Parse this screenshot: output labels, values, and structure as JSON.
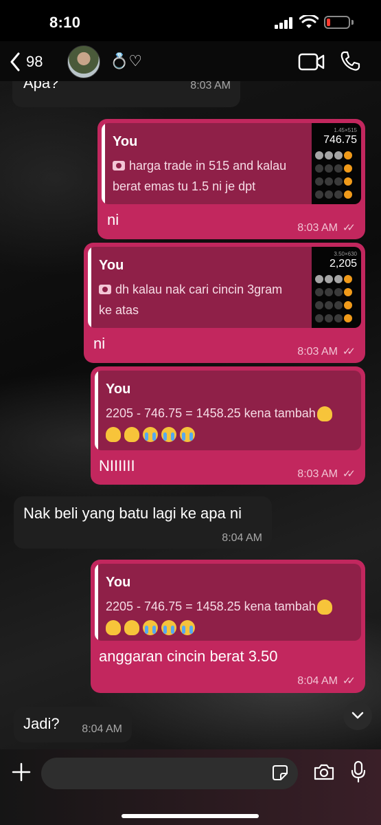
{
  "status_bar": {
    "time": "8:10",
    "battery_level": 0.15,
    "battery_color": "#ff3b30"
  },
  "header": {
    "back_count": "98",
    "contact_name": "💍♡",
    "icons": [
      "chevron-left-icon",
      "video-camera-icon",
      "phone-icon"
    ]
  },
  "colors": {
    "outgoing": "#c2275e",
    "quote": "#8f2048",
    "incoming": "#1f1f1f"
  },
  "messages": [
    {
      "direction": "in",
      "text": "Apa?",
      "time": "8:03 AM"
    },
    {
      "direction": "out",
      "quote": {
        "author": "You",
        "line1": "harga trade in 515 and kalau",
        "line2": "berat emas tu 1.5 ni je dpt",
        "thumb_expr": "1.45×515",
        "thumb_value": "746.75"
      },
      "text": "ni",
      "time": "8:03 AM"
    },
    {
      "direction": "out",
      "quote": {
        "author": "You",
        "line1": "dh kalau nak cari cincin 3gram",
        "line2": "ke atas",
        "thumb_expr": "3.50×630",
        "thumb_value": "2,205"
      },
      "text": "ni",
      "time": "8:03 AM"
    },
    {
      "direction": "out",
      "quote": {
        "author": "You",
        "line1": "2205 - 746.75 = 1458.25 kena tambah"
      },
      "text": "NIIIIII",
      "time": "8:03 AM"
    },
    {
      "direction": "in",
      "text": "Nak beli yang batu lagi ke apa ni",
      "time": "8:04 AM"
    },
    {
      "direction": "out",
      "quote": {
        "author": "You",
        "line1": "2205 - 746.75 = 1458.25 kena tambah"
      },
      "text": "anggaran cincin berat 3.50",
      "time": "8:04 AM"
    },
    {
      "direction": "in",
      "text": "Jadi?",
      "time": "8:04 AM"
    }
  ],
  "composer": {
    "placeholder": ""
  }
}
